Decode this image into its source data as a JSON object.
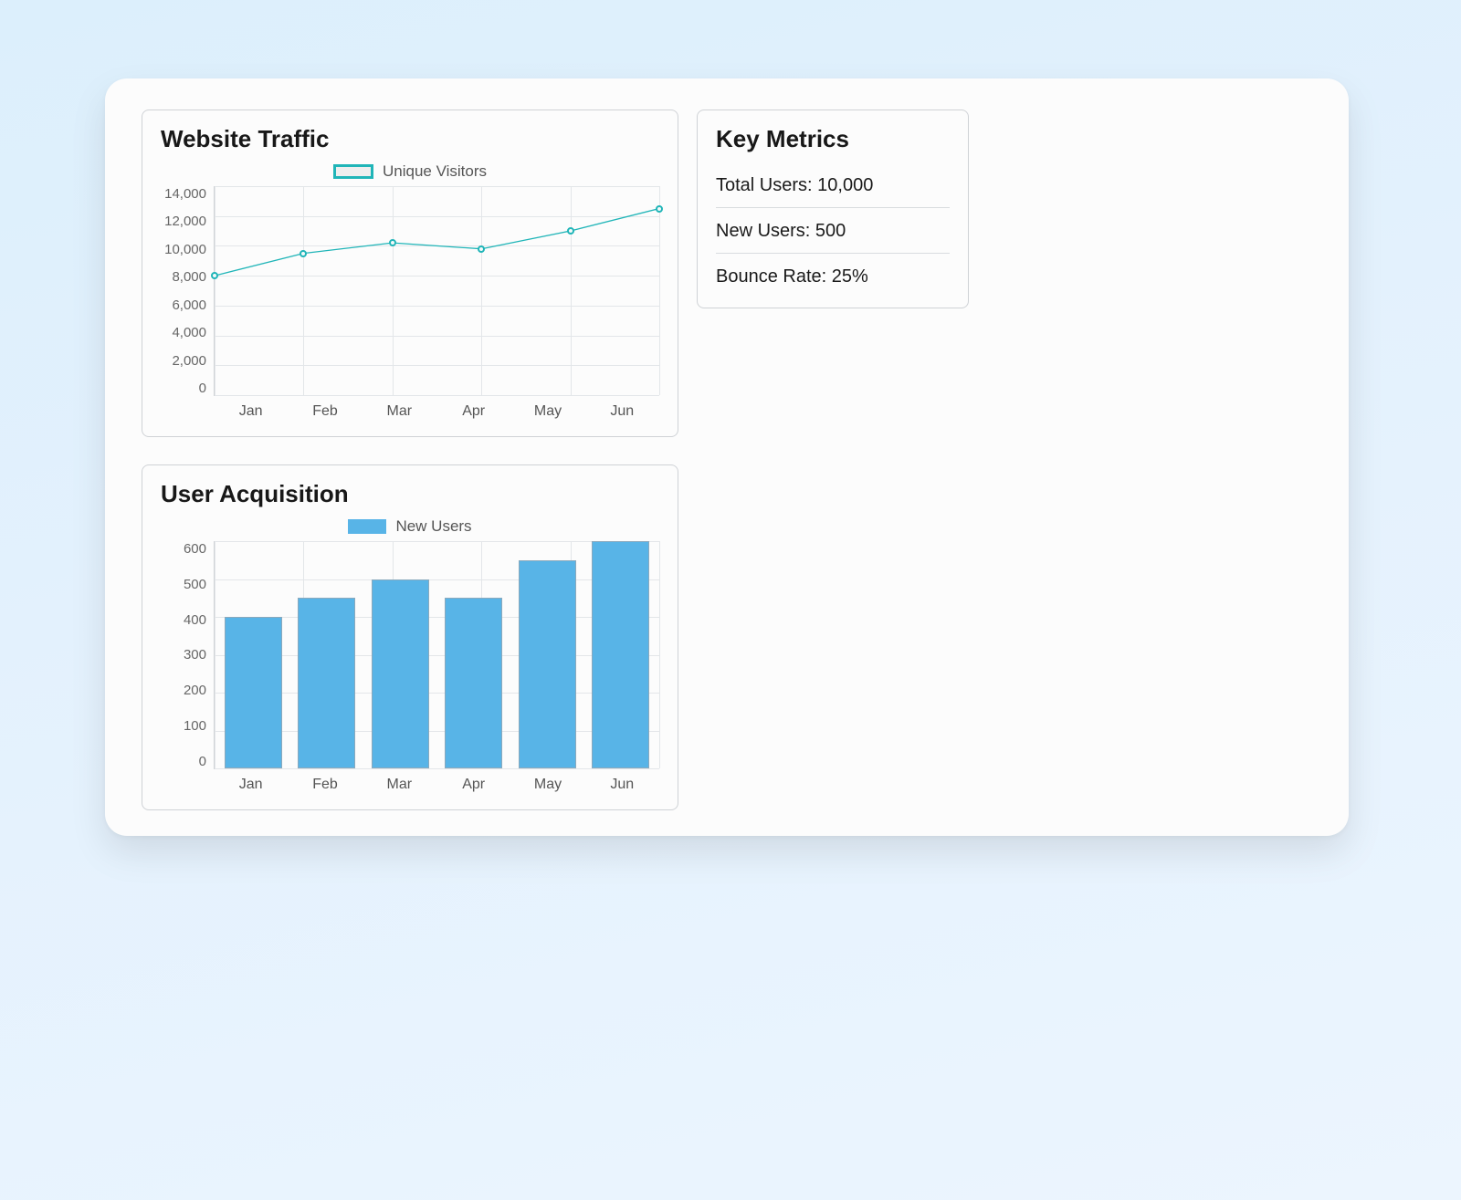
{
  "traffic": {
    "title": "Website Traffic",
    "legend_label": "Unique Visitors"
  },
  "acquisition": {
    "title": "User Acquisition",
    "legend_label": "New Users"
  },
  "metrics": {
    "title": "Key Metrics",
    "items": [
      "Total Users: 10,000",
      "New Users: 500",
      "Bounce Rate: 25%"
    ]
  },
  "chart_data": [
    {
      "id": "website_traffic",
      "type": "line",
      "title": "Website Traffic",
      "legend": [
        "Unique Visitors"
      ],
      "categories": [
        "Jan",
        "Feb",
        "Mar",
        "Apr",
        "May",
        "Jun"
      ],
      "series": [
        {
          "name": "Unique Visitors",
          "values": [
            8000,
            9500,
            10200,
            9800,
            11000,
            12500
          ]
        }
      ],
      "xlabel": "",
      "ylabel": "",
      "ylim": [
        0,
        14000
      ],
      "yticks": [
        0,
        2000,
        4000,
        6000,
        8000,
        10000,
        12000,
        14000
      ],
      "ytick_labels": [
        "0",
        "2,000",
        "4,000",
        "6,000",
        "8,000",
        "10,000",
        "12,000",
        "14,000"
      ],
      "grid": true,
      "line_color": "#20b5b8"
    },
    {
      "id": "user_acquisition",
      "type": "bar",
      "title": "User Acquisition",
      "legend": [
        "New Users"
      ],
      "categories": [
        "Jan",
        "Feb",
        "Mar",
        "Apr",
        "May",
        "Jun"
      ],
      "series": [
        {
          "name": "New Users",
          "values": [
            400,
            450,
            500,
            450,
            550,
            600
          ]
        }
      ],
      "xlabel": "",
      "ylabel": "",
      "ylim": [
        0,
        600
      ],
      "yticks": [
        0,
        100,
        200,
        300,
        400,
        500,
        600
      ],
      "ytick_labels": [
        "0",
        "100",
        "200",
        "300",
        "400",
        "500",
        "600"
      ],
      "grid": true,
      "bar_color": "#58b4e7"
    }
  ]
}
